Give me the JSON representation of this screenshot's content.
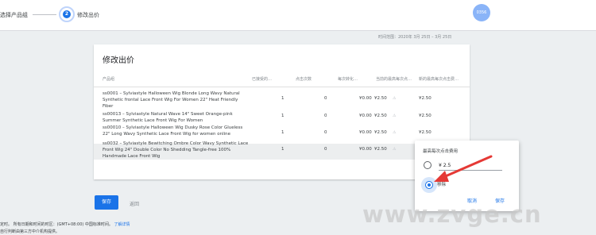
{
  "stepper": {
    "step1_label": "选择产品组",
    "step2_number": "2",
    "step2_label": "修改出价",
    "avatar_text": "0356"
  },
  "date_range": "时间范围：2020年 3月 25日 – 3月 25日",
  "card": {
    "title": "修改出价",
    "columns": [
      "产品组",
      "已接受的…",
      "点击次数",
      "每次转化…",
      "当前的最高每次点…",
      "新的最高每次点击费…"
    ],
    "rows": [
      {
        "name": "ss0001 – Sylviastyle Halloween Wig Blonde Long Wavy Natural Synthetic frontal Lace Front Wig For Women 22\" Heat Friendly Fiber",
        "impressions": "1",
        "clicks": "0",
        "cpc": "¥0.00",
        "current": "¥2.50",
        "new": "¥2.50"
      },
      {
        "name": "ss00013 – Sylviastyle Natural Wave 14\" Sweet Orange-pink Summer Synthetic Lace Front Wig For Women",
        "impressions": "1",
        "clicks": "0",
        "cpc": "¥0.00",
        "current": "¥2.50",
        "new": "¥2.50"
      },
      {
        "name": "ss00010 – Sylviastyle Halloween Wig Dusky Rose Color Glueless 22\" Long Wavy Synthetic Lace Front Wig for women online",
        "impressions": "1",
        "clicks": "0",
        "cpc": "¥0.00",
        "current": "¥2.50",
        "new": "¥2.50"
      },
      {
        "name": "ss0032 – Sylviastyle Bewitching Ombre Color Wavy Synthetic Lace Front Wig 24\" Double Color No Shedding Tangle-free 100% Handmade Lace Front Wig",
        "impressions": "1",
        "clicks": "0",
        "cpc": "¥0.00",
        "current": "¥2.50",
        "new": ""
      }
    ]
  },
  "actions": {
    "save_label": "保存",
    "back_label": "返回"
  },
  "footer": {
    "line1": "定时。 所有日期和时间的时区：(GMT+08:00) 中国标准时间。",
    "link": "了解详情",
    "line2": "自行判断由第三方中介机构提供。"
  },
  "popup": {
    "title": "最高每次点击费用",
    "price_value": "¥ 2.5",
    "option2_label": "移除",
    "cancel_label": "取消",
    "save_label": "保存"
  },
  "watermark": "www.zvge.cn",
  "colors": {
    "accent": "#1a73e8",
    "arrow": "#e53935"
  }
}
